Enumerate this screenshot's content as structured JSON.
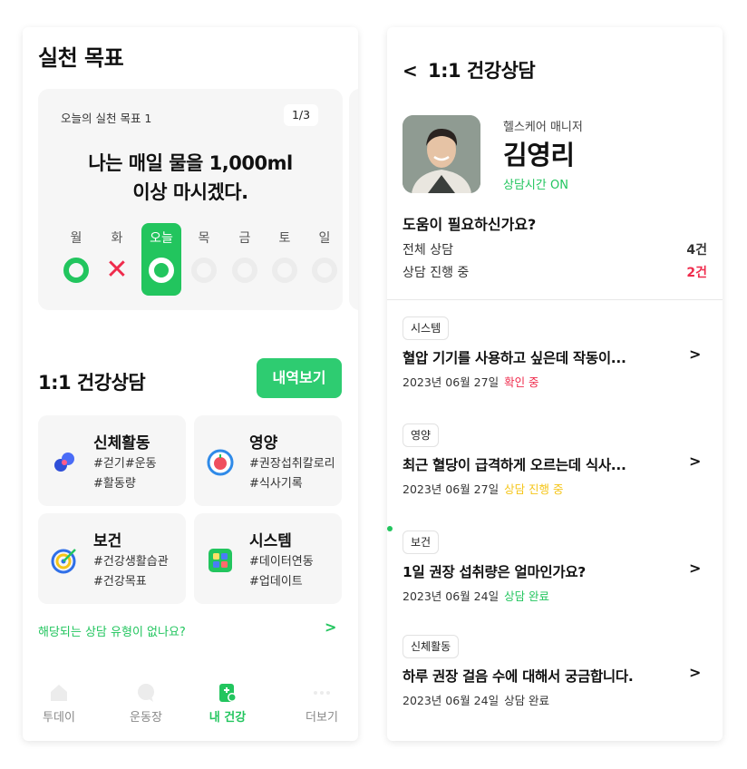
{
  "colors": {
    "accent": "#22c55e",
    "danger": "#ef2b4c",
    "warn": "#f5c518"
  },
  "left": {
    "title": "실천 목표",
    "goal": {
      "subtitle": "오늘의 실천 목표 1",
      "page": "1/3",
      "text_line1": "나는 매일 물을 1,000ml",
      "text_line2": "이상 마시겠다.",
      "days": [
        {
          "label": "월",
          "state": "done"
        },
        {
          "label": "화",
          "state": "missed"
        },
        {
          "label": "오늘",
          "state": "today"
        },
        {
          "label": "목",
          "state": "pending"
        },
        {
          "label": "금",
          "state": "pending"
        },
        {
          "label": "토",
          "state": "pending"
        },
        {
          "label": "일",
          "state": "pending"
        }
      ]
    },
    "consult_title": "1:1 건강상담",
    "history_button": "내역보기",
    "categories": [
      {
        "title": "신체활동",
        "tag1": "#걷기#운동",
        "tag2": "#활동량",
        "icon": "dumbbell-icon"
      },
      {
        "title": "영양",
        "tag1": "#권장섭취칼로리",
        "tag2": "#식사기록",
        "icon": "apple-icon"
      },
      {
        "title": "보건",
        "tag1": "#건강생활습관",
        "tag2": "#건강목표",
        "icon": "target-icon"
      },
      {
        "title": "시스템",
        "tag1": "#데이터연동",
        "tag2": "#업데이트",
        "icon": "grid-icon"
      }
    ],
    "help_text": "해당되는 상담 유형이 없나요?",
    "nav": [
      {
        "label": "투데이",
        "icon": "home-icon"
      },
      {
        "label": "운동장",
        "icon": "chat-icon"
      },
      {
        "label": "내 건강",
        "icon": "health-icon"
      },
      {
        "label": "더보기",
        "icon": "more-icon"
      }
    ]
  },
  "right": {
    "title": "1:1 건강상담",
    "manager": {
      "role": "헬스케어 매니저",
      "name": "김영리",
      "status": "상담시간 ON"
    },
    "help_question": "도움이 필요하신가요?",
    "stats": [
      {
        "label": "전체 상담",
        "value": "4건"
      },
      {
        "label": "상담 진행 중",
        "value": "2건"
      }
    ],
    "items": [
      {
        "tag": "시스템",
        "title": "혈압 기기를 사용하고 싶은데 작동이...",
        "date": "2023년 06월 27일",
        "status": "확인 중"
      },
      {
        "tag": "영양",
        "title": "최근 혈당이 급격하게 오르는데 식사...",
        "date": "2023년 06월 27일",
        "status": "상담 진행 중"
      },
      {
        "tag": "보건",
        "title": "1일 권장 섭취량은 얼마인가요?",
        "date": "2023년 06월 24일",
        "status": "상담 완료"
      },
      {
        "tag": "신체활동",
        "title": "하루 권장 걸음 수에 대해서 궁금합니다.",
        "date": "2023년 06월 24일",
        "status": "상담 완료"
      }
    ]
  }
}
